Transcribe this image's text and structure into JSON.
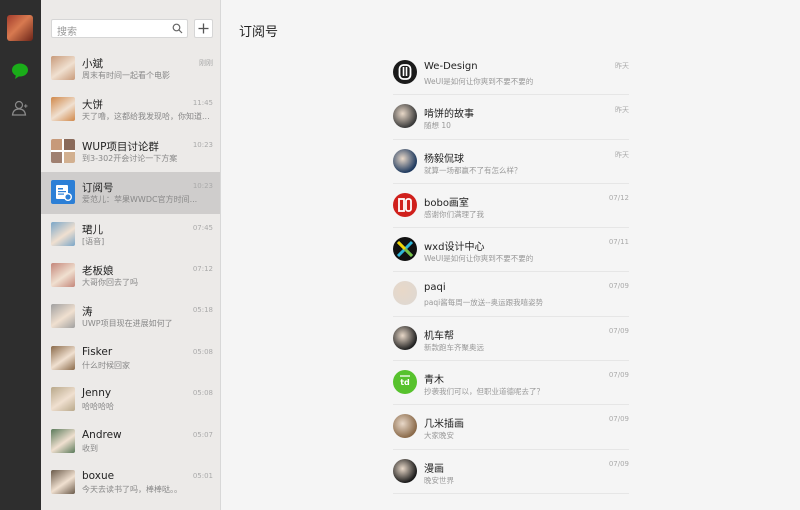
{
  "search": {
    "placeholder": "搜索"
  },
  "colors": {
    "rail": "#2e2e2e",
    "accent_green": "#1aad19",
    "list_bg": "#eceae8",
    "selected": "#cfcdcc",
    "main_bg": "#f5f5f5"
  },
  "chats": [
    {
      "name": "小斌",
      "preview": "周末有时间一起看个电影",
      "time": "刚刚",
      "avatar_color": "#c89a7a"
    },
    {
      "name": "大饼",
      "preview": "天了噜，这都给我发现哈，你知道...",
      "time": "11:45",
      "avatar_color": "#d0884a"
    },
    {
      "name": "WUP项目讨论群",
      "preview": "到3-302开会讨论一下方案",
      "time": "10:23",
      "avatar_color": "#9a7a6a"
    },
    {
      "name": "订阅号",
      "preview": "爱范儿：苹果WWDC官方时间...",
      "time": "10:23",
      "avatar_color": "#2c7fd6"
    },
    {
      "name": "珺儿",
      "preview": "[语音]",
      "time": "07:45",
      "avatar_color": "#7aa6c8"
    },
    {
      "name": "老板娘",
      "preview": "大哥你回去了吗",
      "time": "07:12",
      "avatar_color": "#c4867a"
    },
    {
      "name": "涛",
      "preview": "UWP项目现在进展如何了",
      "time": "05:18",
      "avatar_color": "#a0a0a0"
    },
    {
      "name": "Fisker",
      "preview": "什么时候回家",
      "time": "05:08",
      "avatar_color": "#8a6a4a"
    },
    {
      "name": "Jenny",
      "preview": "哈哈哈哈",
      "time": "05:08",
      "avatar_color": "#b8a88a"
    },
    {
      "name": "Andrew",
      "preview": "收到",
      "time": "05:07",
      "avatar_color": "#5a7a5a"
    },
    {
      "name": "boxue",
      "preview": "今天去读书了吗，棒棒哒。。",
      "time": "05:01",
      "avatar_color": "#6a5a4a"
    }
  ],
  "main": {
    "title": "订阅号",
    "subscriptions": [
      {
        "name": "We-Design",
        "preview": "WeUI是如何让你爽到不要不要的",
        "time": "昨天",
        "icon": "we-design-logo",
        "avatar_color": "#1b1b1b"
      },
      {
        "name": "啃饼的故事",
        "preview": "随想 10",
        "time": "昨天",
        "icon": "photo-avatar",
        "avatar_color": "#3a3a3a"
      },
      {
        "name": "杨毅侃球",
        "preview": "就算一场都赢不了有怎么样？",
        "time": "昨天",
        "icon": "photo-avatar",
        "avatar_color": "#1f3a5f"
      },
      {
        "name": "bobo画室",
        "preview": "感谢你们满理了我",
        "time": "07/12",
        "icon": "bobo-logo",
        "avatar_color": "#d0201c"
      },
      {
        "name": "wxd设计中心",
        "preview": "WeUI是如何让你爽到不要不要的",
        "time": "07/11",
        "icon": "wxd-logo",
        "avatar_color": "#111111"
      },
      {
        "name": "paqi",
        "preview": "paqi酱每周一放送--奥运跟我嘻姿势",
        "time": "07/09",
        "icon": "photo-avatar",
        "avatar_color": "#e0d8d0"
      },
      {
        "name": "机车帮",
        "preview": "新款跑车齐聚奥远",
        "time": "07/09",
        "icon": "photo-avatar",
        "avatar_color": "#222222"
      },
      {
        "name": "青木",
        "preview": "抄袭我们可以，但职业道德呢去了？",
        "time": "07/09",
        "icon": "td-logo",
        "avatar_color": "#57c22d"
      },
      {
        "name": "几米插画",
        "preview": "大家晚安",
        "time": "07/09",
        "icon": "photo-avatar",
        "avatar_color": "#8a6a4a"
      },
      {
        "name": "漫画",
        "preview": "晚安世界",
        "time": "07/09",
        "icon": "photo-avatar",
        "avatar_color": "#1a1a1a"
      }
    ]
  }
}
